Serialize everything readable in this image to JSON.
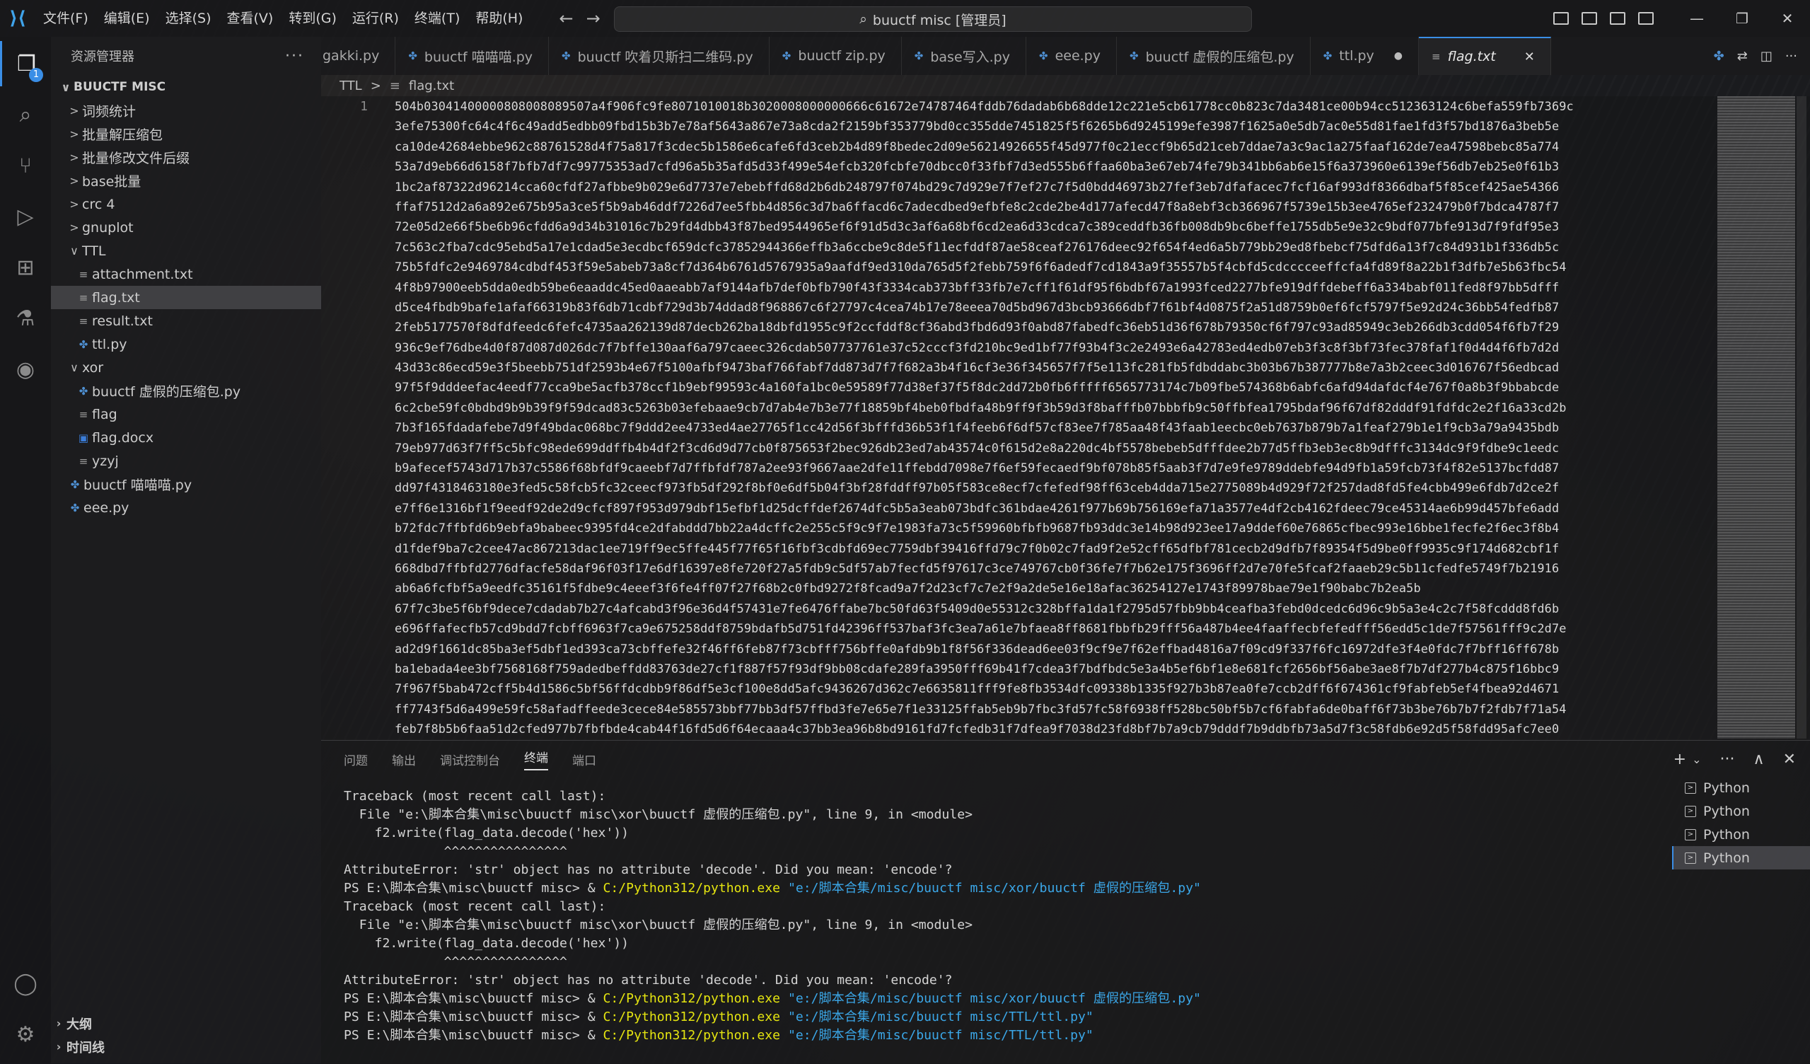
{
  "titlebar": {
    "menu": [
      "文件(F)",
      "编辑(E)",
      "选择(S)",
      "查看(V)",
      "转到(G)",
      "运行(R)",
      "终端(T)",
      "帮助(H)"
    ],
    "search_text": "buuctf misc [管理员]"
  },
  "sidebar": {
    "title": "资源管理器",
    "more": "···",
    "root": "BUUCTF MISC",
    "items": [
      {
        "label": "词频统计",
        "chev": ">"
      },
      {
        "label": "批量解压缩包",
        "chev": ">"
      },
      {
        "label": "批量修改文件后缀",
        "chev": ">"
      },
      {
        "label": "base批量",
        "chev": ">"
      },
      {
        "label": "crc 4",
        "chev": ">"
      },
      {
        "label": "gnuplot",
        "chev": ">"
      },
      {
        "label": "TTL",
        "chev": "∨"
      },
      {
        "label": "attachment.txt"
      },
      {
        "label": "flag.txt"
      },
      {
        "label": "result.txt"
      },
      {
        "label": "ttl.py"
      },
      {
        "label": "xor",
        "chev": "∨"
      },
      {
        "label": "buuctf 虚假的压缩包.py"
      },
      {
        "label": "flag"
      },
      {
        "label": "flag.docx"
      },
      {
        "label": "yzyj"
      },
      {
        "label": "buuctf 喵喵喵.py"
      },
      {
        "label": "eee.py"
      }
    ],
    "outline": "大纲",
    "timeline": "时间线"
  },
  "tabs": [
    {
      "label": "gakki.py"
    },
    {
      "label": "buuctf 喵喵喵.py"
    },
    {
      "label": "buuctf 吹着贝斯扫二维码.py"
    },
    {
      "label": "buuctf zip.py"
    },
    {
      "label": "base写入.py"
    },
    {
      "label": "eee.py"
    },
    {
      "label": "buuctf 虚假的压缩包.py"
    },
    {
      "label": "ttl.py",
      "modified_dot": "●"
    },
    {
      "label": "flag.txt",
      "close": "✕"
    }
  ],
  "breadcrumb": [
    "TTL",
    ">",
    "flag.txt"
  ],
  "editor": {
    "line_number": "1",
    "lines": [
      "504b03041400000808008089507a4f906fc9fe8071010018b3020008000000666c61672e74787464fddb76dadab6b68dde12c221e5cb61778cc0b823c7da3481ce00b94cc512363124c6befa559fb7369c",
      "3efe75300fc64c4f6c49add5edbb09fbd15b3b7e78af5643a867e73a8cda2f2159bf353779bd0cc355dde7451825f5f6265b6d9245199efe3987f1625a0e5db7ac0e55d81fae1fd3f57bd1876a3beb5e",
      "ca10de42684ebbe962c88761528d4f75a817f3cdec5b1586e6cafe6fd3ceb2b4d89f8bedec2d09e56214926655f45d977f0c21eccf9b65d21ceb7ddae7a3c9ac1a275faaf162de7ea47598bebc85a774",
      "53a7d9eb66d6158f7bfb7df7c99775353ad7cfd96a5b35afd5d33f499e54efcb320fcbfe70dbcc0f33fbf7d3ed555b6ffaa60ba3e67eb74fe79b341bb6ab6e15f6a373960e6139ef56db7eb25e0f61b3",
      "1bc2af87322d96214cca60cfdf27afbbe9b029e6d7737e7ebebffd68d2b6db248797f074bd29c7d929e7f7ef27c7f5d0bdd46973b27fef3eb7dfafacec7fcf16af993df8366dbaf5f85cef425ae54366",
      "ffaf7512d2a6a892e675b95a3ce5f5b9ab46ddf7226d7ee5fbb4d856c3d7ba6ffacd6c7adecdbed9efbfe8c2cde2be4d177afecd47f8a8ebf3cb366967f5739e15b3ee4765ef232479b0f7bdca4787f7",
      "72e05d2e66f5be6b96cfdd6a9d34b31016c7b29fd4dbb43f87bed9544965ef6f91d5d3c3af6a68bf6cd2ea6d33cdca7c389ceddfb36fb008db9bc6beffe1755db5e9e32c9bdf077bfe913d7f9fdf95e3",
      "7c563c2fba7cdc95ebd5a17e1cdad5e3ecdbcf659dcfc37852944366effb3a6ccbe9c8de5f11ecfddf87ae58ceaf276176deec92f654f4ed6a5b779bb29ed8fbebcf75dfd6a13f7c84d931b1f336db5c",
      "75b5fdfc2e9469784cdbdf453f59e5abeb73a8cf7d364b6761d5767935a9aafdf9ed310da765d5f2febb759f6f6adedf7cd1843a9f35557b5f4cbfd5cdcccceeffcfa4fd89f8a22b1f3dfb7e5b63fbc54",
      "4f8b97900eeb5dda0edb59be6eaaddc45ed0aaeabb7af9144afb7def0bfb790f43f3334cab373bff33fb7e7cff1f61df95f6bdbf67a1993fced2277bfe919dffdebeff6a334babf011fed8f97bb5dfff",
      "d5ce4fbdb9bafe1afaf66319b83f6db71cdbf729d3b74ddad8f968867c6f27797c4cea74b17e78eeea70d5bd967d3bcb93666dbf7f61bf4d0875f2a51d8759b0ef6fcf5797f5e92d24c36bb54fedfb87",
      "2feb5177570f8dfdfeedc6fefc4735aa262139d87decb262ba18dbfd1955c9f2ccfddf8cf36abd3fbd6d93f0abd87fabedfc36eb51d36f678b79350cf6f797c93ad85949c3eb266db3cdd054f6fb7f29",
      "936c9ef76dbe4d0f87d087d026dc7f7bffe130aaf6a797caeec326cdab507737761e37c52cccf3fd210bc9ed1bf77f93b4f3c2e2493e6a42783ed4edb07eb3f3c8f3bf73fec378faf1f0d4d4f6fb7d2d",
      "43d33c86ecd59e3f5beebb751df2593b4e67f5100afbf9473baf766fabf7dd873d7f7f682a3b4f16cf3e36f345657f7f5e113fc281fb5fdbddabc3b03b67b387777b8e7a3b2ceec3d016767f56edbcad",
      "97f5f9dddeefac4eedf77cca9be5acfb378ccf1b9ebf99593c4a160fa1bc0e59589f77d38ef37f5f8dc2dd72b0fb6fffff6565773174c7b09fbe574368b6abfc6afd94dafdcf4e767f0a8b3f9bbabcde",
      "6c2cbe59fc0bdbd9b9b39f9f59dcad83c5263b03efebaae9cb7d7ab4e7b3e77f18859bf4beb0fbdfa48b9ff9f3b59d3f8bafffb07bbbfb9c50ffbfea1795bdaf96f67df82dddf91fdfdc2e2f16a33cd2b",
      "7b3f165fdadafebe7d9f49bdac068bc7f9ddd2ee4733ed4ae27765f1cc42d56f3bfffd36b53f1f4feeb6f6df57cf83ee7f785aa48f43faab1eecbc0eb7637b879b7a1feaf279b1e1f9cb3a79a9435bdb",
      "79eb977d63f7ff5c5bfc98ede699ddffb4b4df2f3cd6d9d77cb0f875653f2bec926db23ed7ab43574c0f615d2e8a220dc4bf5578bebeb5dfffdee2b77d5ffb3eb3ec8b9dfffc3134dc9f9fdbe9c1eedc",
      "b9afecef5743d717b37c5586f68bfdf9caeebf7d7ffbfdf787a2ee93f9667aae2dfe11ffebdd7098e7f6ef59fecaedf9bf078b85f5aab3f7d7e9fe9789ddebfe94d9fb1a59fcb73f4f82e5137bcfdd87",
      "dd97f4318463180e3fed5c58fcb5fc32ceecf973fb5df292f8bf0e6df5b04f3bf28fddff97b05f583ce8ecf7cfefedf98ff63ceb4dda715e2775089b4d929f72f257dad8fd5fe4cbb499e6fdb7d2ce2f",
      "e7ff6e1316bf1f9eedf92de2d9cfcf897f953d979dbf15efbf1d25dcffdef2674dfc5b5a3eab073bdfc361bdae4261f977b69b756169efa71a3577e4df2cb4162fdeec79ce45314ae6b99d457bfe6add",
      "b72fdc7ffbfd6b9ebfa9babeec9395fd4ce2dfabddd7bb22a4dcffc2e255c5f9c9f7e1983fa73c5f59960bfbfb9687fb93ddc3e14b98d923ee17a9ddef60e76865cfbec993e16bbe1fecfe2f6ec3f8b4",
      "d1fdef9ba7c2cee47ac867213dac1ee719ff9ec5ffe445f77f65f16fbf3cdbfd69ec7759dbf39416ffd79c7f0b02c7fad9f2e52cff65dfbf781cecb2d9dfb7f89354f5d9be0ff9935c9f174d682cbf1f",
      "668dbd7ffbfd2776dfacfe58daf96f03f17e6df16397e8fe720f27a5fdb9c5df57ab7fecfd5f97617c3ce749767cb0f36fe7f7b62e175f3696ff2d7e70fe5fcaf2faaeb29c5b11cfedfe5749f7b21916",
      "ab6a6fcfbf5a9eedfc35161f5fdbe9c4eeef3f6fe4ff07f27f68b2c0fbd9272f8fcad9a7f2d23cf7c7e2f9a2de5e16e18afac36254127e1743f89978bae79e1f90babc7b2ea5b",
      "67f7c3be5f6bf9dece7cdadab7b27c4afcabd3f96e36d4f57431e7fe6476ffabe7bc50fd63f5409d0e55312c328bffa1da1f2795d57fbb9bb4ceafba3febd0dcedc6d96c9b5a3e4c2c7f58fcddd8fd6b",
      "e696ffafecfb57cd9bdd7fcbff6963f7ca9e675258ddf8759bdafb5d751fd42396ff537baf3fc3ea7a61e7bfaea8ff8681fbbfb29fff56a487b4ee4faaffecbfefedfff56edd5c1de7f57561fff9c2d7e",
      "ad2d9f1661dc85ba3ef5dbf1ed393ca73cbffefe32f46ff6feb87f73cbfff756bffe0afdb9b1f8f56f336dead6ee03f9cf9e7f62effbad4816a7f09cd9f337f6fc16972dfe3f4e0fdc7f7bff16ff678b",
      "ba1ebada4ee3bf7568168f759adedbeffdd83763de27cf1f887f57f93df9bb08cdafe289fa3950fff69b41f7cdea3f7bdfbdc5e3a4b5ef6bf1e8e681fcf2656bf56abe3ae8f7b7df277b4c875f16bbc9",
      "7f967f5bab472cff5b4d1586c5bf56ffdcdbb9f86df5e3cf100e8dd5afc9436267d362c7e6635811fff9fe8fb3534dfc09338b1335f927b3b87ea0fe7ccb2dff6f674361cf9fabfeb5ef4fbea92d4671",
      "ff7743f5d6a499e59fc58afadffeede3cece84e585573bbf77bb3df57ffbd3fe7e65e7f1e33125ffab5eb9b7fbc3fd57fc58f6938ff528bc50bf5b7cf6fabfa6de0baff6f73b3be76b7b7f2fdb7f71a54",
      "feb7f8b5b6faa51d2cfed977b7fbfbde4cab44f16fd5d6f64ecaaa4c37bb3ea96b8bd9161fd7fcfedb31f7dfea9f7038d23fd8bf7b7a9cb79dddf7b9ddbfb73a5d7f3c58fdb6e92d5f58fdd95afc7ee0"
    ]
  },
  "panel": {
    "tabs": [
      "问题",
      "输出",
      "调试控制台",
      "终端",
      "端口"
    ],
    "active_tab": "终端",
    "actions": [
      "+",
      "⌄",
      "···",
      "∧",
      "✕"
    ],
    "terminal_lines": [
      {
        "text": "Traceback (most recent call last):"
      },
      {
        "text": "  File \"e:\\脚本合集\\misc\\buuctf misc\\xor\\buuctf 虚假的压缩包.py\", line 9, in <module>"
      },
      {
        "text": "    f2.write(flag_data.decode('hex'))"
      },
      {
        "text": "             ^^^^^^^^^^^^^^^^"
      },
      {
        "text": "AttributeError: 'str' object has no attribute 'decode'. Did you mean: 'encode'?"
      },
      {
        "text": "PS E:\\脚本合集\\misc\\buuctf misc> & ",
        "exe": "C:/Python312/python.exe",
        "arg": " \"e:/脚本合集/misc/buuctf misc/xor/buuctf 虚假的压缩包.py\""
      },
      {
        "text": "Traceback (most recent call last):"
      },
      {
        "text": "  File \"e:\\脚本合集\\misc\\buuctf misc\\xor\\buuctf 虚假的压缩包.py\", line 9, in <module>"
      },
      {
        "text": "    f2.write(flag_data.decode('hex'))"
      },
      {
        "text": "             ^^^^^^^^^^^^^^^^"
      },
      {
        "text": "AttributeError: 'str' object has no attribute 'decode'. Did you mean: 'encode'?"
      },
      {
        "text": "PS E:\\脚本合集\\misc\\buuctf misc> & ",
        "exe": "C:/Python312/python.exe",
        "arg": " \"e:/脚本合集/misc/buuctf misc/xor/buuctf 虚假的压缩包.py\""
      },
      {
        "text": "PS E:\\脚本合集\\misc\\buuctf misc> & ",
        "exe": "C:/Python312/python.exe",
        "arg": " \"e:/脚本合集/misc/buuctf misc/TTL/ttl.py\""
      },
      {
        "text": "PS E:\\脚本合集\\misc\\buuctf misc> & ",
        "exe": "C:/Python312/python.exe",
        "arg": " \"e:/脚本合集/misc/buuctf misc/TTL/ttl.py\""
      }
    ],
    "terminal_list": [
      "Python",
      "Python",
      "Python",
      "Python"
    ]
  },
  "activity_badge": "1",
  "colors": {
    "accent": "#3a8ee6",
    "exe": "#e5e510",
    "arg": "#3ba7e8"
  }
}
